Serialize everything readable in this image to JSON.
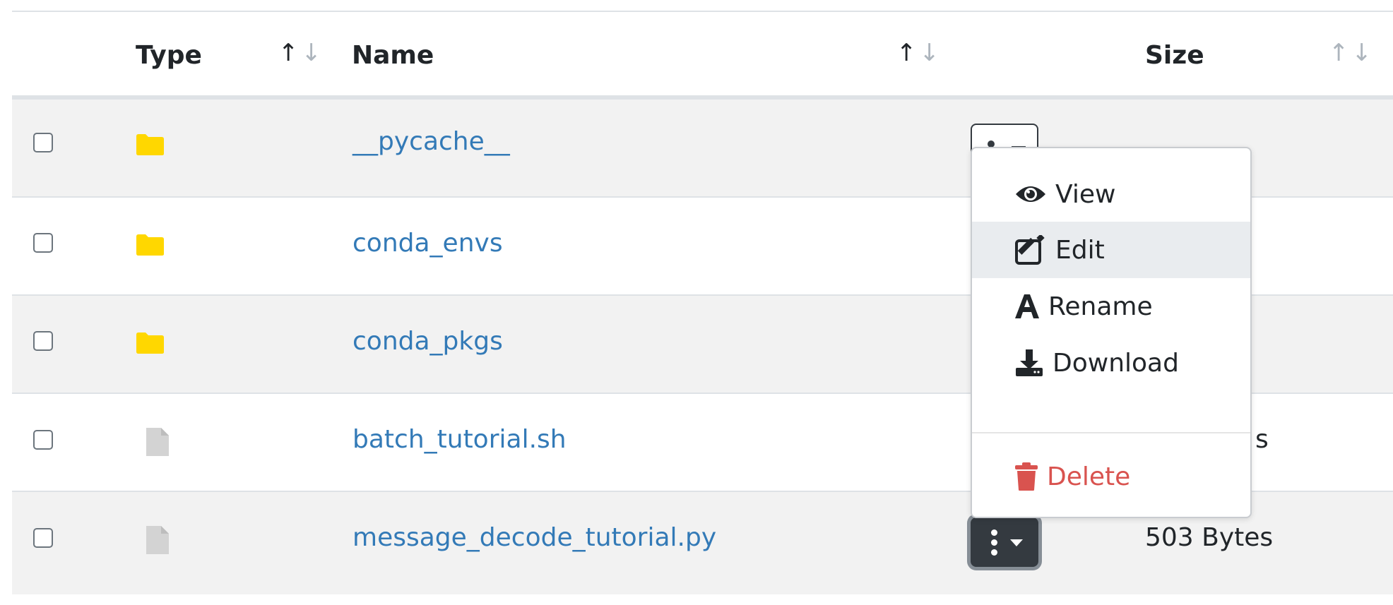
{
  "table": {
    "headers": {
      "type": "Type",
      "name": "Name",
      "size": "Size"
    },
    "rows": [
      {
        "type": "folder",
        "name": "__pycache__",
        "size": ""
      },
      {
        "type": "folder",
        "name": "conda_envs",
        "size": ""
      },
      {
        "type": "folder",
        "name": "conda_pkgs",
        "size": ""
      },
      {
        "type": "file",
        "name": "batch_tutorial.sh",
        "size": "s"
      },
      {
        "type": "file",
        "name": "message_decode_tutorial.py",
        "size": "503 Bytes"
      }
    ]
  },
  "dropdown": {
    "items": [
      {
        "label": "View",
        "icon": "eye-icon"
      },
      {
        "label": "Edit",
        "icon": "edit-icon",
        "active": true
      },
      {
        "label": "Rename",
        "icon": "rename-icon"
      },
      {
        "label": "Download",
        "icon": "download-icon"
      }
    ],
    "delete_label": "Delete"
  },
  "colors": {
    "link": "#337ab7",
    "folder": "#ffd700",
    "file": "#d3d3d3",
    "danger": "#d9534f",
    "button_dark": "#343a40"
  }
}
